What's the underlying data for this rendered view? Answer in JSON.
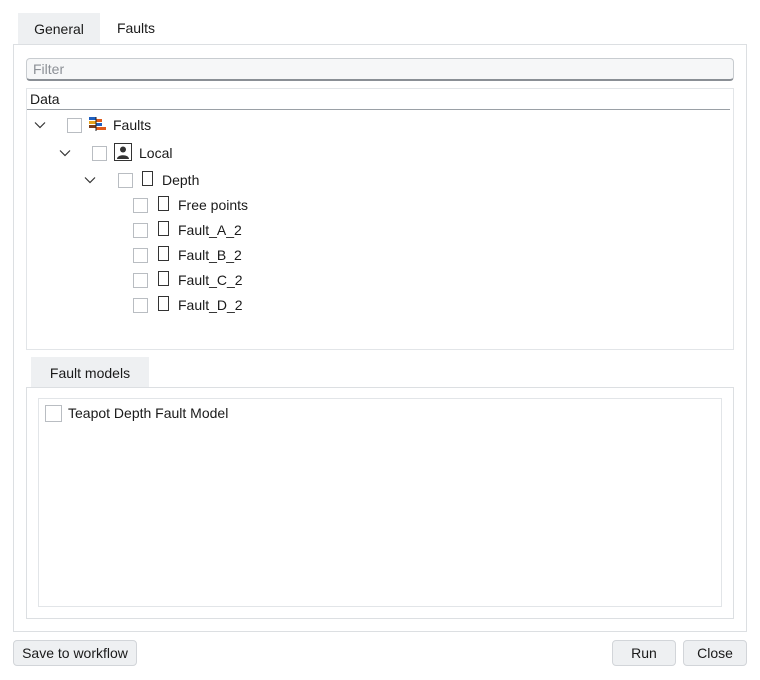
{
  "tabs": [
    {
      "label": "General",
      "active": true
    },
    {
      "label": "Faults",
      "active": false
    }
  ],
  "filter": {
    "placeholder": "Filter",
    "value": ""
  },
  "tree": {
    "header": "Data",
    "items": [
      {
        "label": "Faults",
        "icon": "faults-icon",
        "expanded": true,
        "checked": false
      },
      {
        "label": "Local",
        "icon": "local-folder-icon",
        "expanded": true,
        "checked": false
      },
      {
        "label": "Depth",
        "icon": "folder-icon",
        "expanded": true,
        "checked": false
      },
      {
        "label": "Free points",
        "icon": "item-icon",
        "checked": false
      },
      {
        "label": "Fault_A_2",
        "icon": "item-icon",
        "checked": false
      },
      {
        "label": "Fault_B_2",
        "icon": "item-icon",
        "checked": false
      },
      {
        "label": "Fault_C_2",
        "icon": "item-icon",
        "checked": false
      },
      {
        "label": "Fault_D_2",
        "icon": "item-icon",
        "checked": false
      }
    ]
  },
  "fault_models": {
    "tab_label": "Fault models",
    "items": [
      {
        "label": "Teapot Depth Fault Model",
        "checked": false
      }
    ]
  },
  "footer": {
    "save_label": "Save to workflow",
    "run_label": "Run",
    "close_label": "Close"
  },
  "colors": {
    "tab_active_bg": "#eef0f2",
    "button_bg": "#eef0f2",
    "border": "#dcdfe2"
  }
}
